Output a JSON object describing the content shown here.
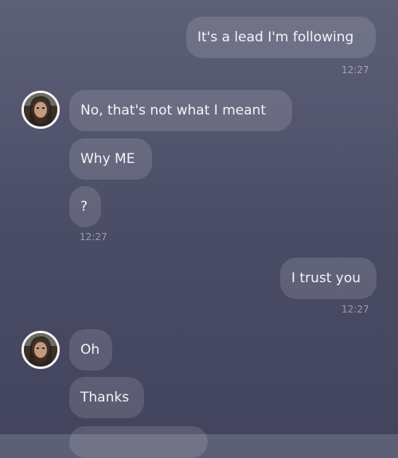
{
  "messages": [
    {
      "id": "m1",
      "text": "It's a lead I'm following",
      "time": "12:27"
    },
    {
      "id": "m2",
      "text": "No, that's not what I meant"
    },
    {
      "id": "m3",
      "text": "Why ME"
    },
    {
      "id": "m4",
      "text": "?",
      "time": "12:27"
    },
    {
      "id": "m5",
      "text": "I trust you",
      "time": "12:27"
    },
    {
      "id": "m6",
      "text": "Oh"
    },
    {
      "id": "m7",
      "text": "Thanks"
    }
  ],
  "icons": {
    "avatar": "user-avatar"
  },
  "colors": {
    "background_top": "#5d6077",
    "background_bottom": "#43445e",
    "bubble": "rgba(255,255,255,0.13)"
  }
}
